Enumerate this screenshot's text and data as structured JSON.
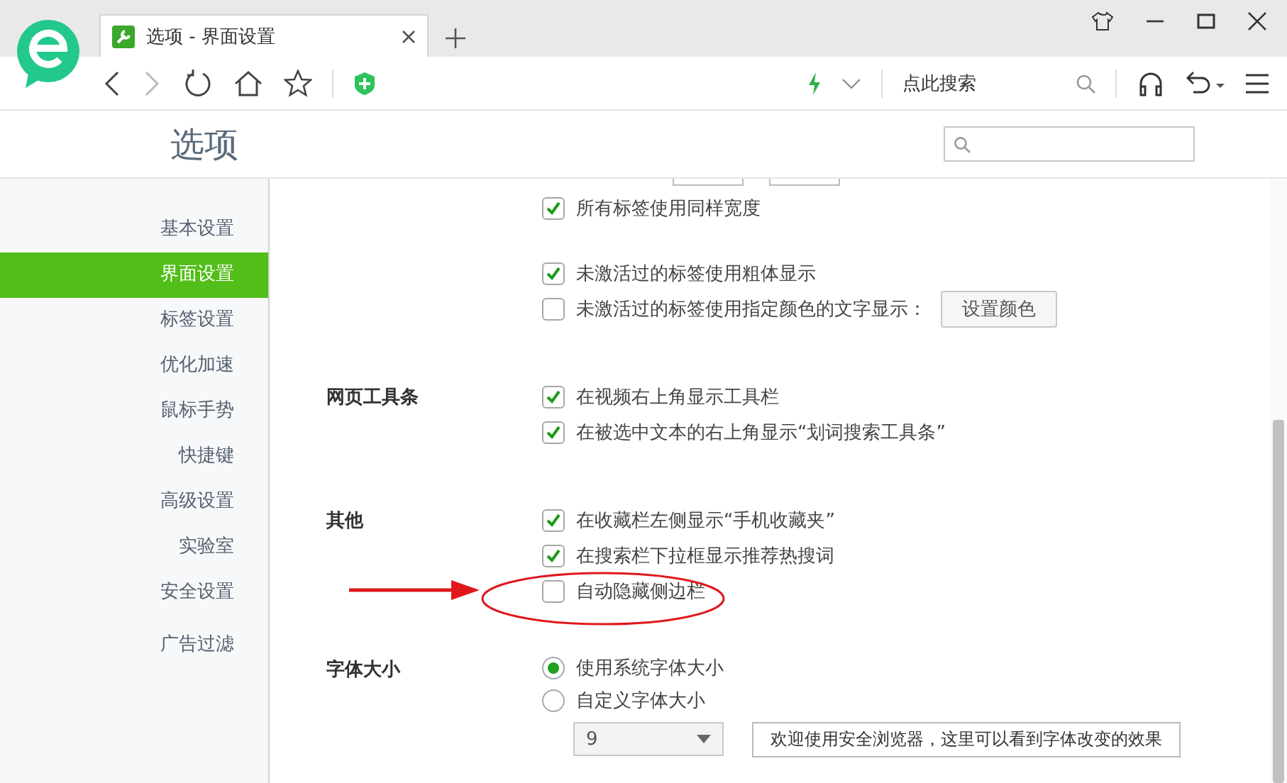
{
  "tab": {
    "title": "选项 - 界面设置"
  },
  "toolbar": {
    "search_text": "点此搜索"
  },
  "page": {
    "title": "选项"
  },
  "sidebar": {
    "items": [
      {
        "label": "基本设置",
        "selected": false
      },
      {
        "label": "界面设置",
        "selected": true
      },
      {
        "label": "标签设置",
        "selected": false
      },
      {
        "label": "优化加速",
        "selected": false
      },
      {
        "label": "鼠标手势",
        "selected": false
      },
      {
        "label": "快捷键",
        "selected": false
      },
      {
        "label": "高级设置",
        "selected": false
      },
      {
        "label": "实验室",
        "selected": false
      },
      {
        "label": "安全设置",
        "selected": false
      },
      {
        "label": "广告过滤",
        "selected": false
      }
    ]
  },
  "sections": [
    {
      "options": [
        {
          "label": "所有标签使用同样宽度",
          "checked": true
        }
      ]
    },
    {
      "options": [
        {
          "label": "未激活过的标签使用粗体显示",
          "checked": true
        },
        {
          "label": "未激活过的标签使用指定颜色的文字显示：",
          "checked": false,
          "button": "设置颜色"
        }
      ]
    },
    {
      "label": "网页工具条",
      "options": [
        {
          "label": "在视频右上角显示工具栏",
          "checked": true
        },
        {
          "label": "在被选中文本的右上角显示“划词搜索工具条”",
          "checked": true
        }
      ]
    },
    {
      "label": "其他",
      "options": [
        {
          "label": "在收藏栏左侧显示“手机收藏夹”",
          "checked": true
        },
        {
          "label": "在搜索栏下拉框显示推荐热搜词",
          "checked": true
        },
        {
          "label": "自动隐藏侧边栏",
          "checked": false,
          "highlighted": true
        }
      ]
    }
  ],
  "font_size": {
    "label": "字体大小",
    "options": [
      {
        "label": "使用系统字体大小",
        "selected": true
      },
      {
        "label": "自定义字体大小",
        "selected": false
      }
    ],
    "size_value": "9",
    "preview": "欢迎使用安全浏览器，这里可以看到字体改变的效果"
  }
}
